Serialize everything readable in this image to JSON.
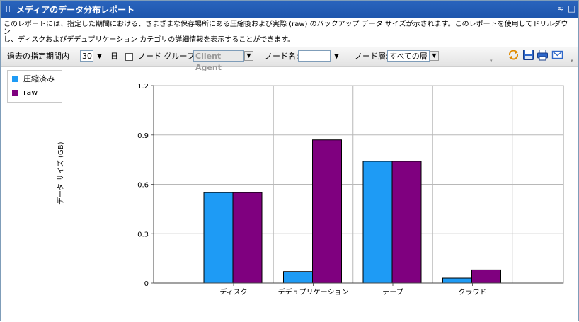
{
  "window": {
    "title": "メディアのデータ分布レポート",
    "grip": "|||",
    "collapse_icon": "≈",
    "maximize_icon": "□"
  },
  "description": {
    "line1": "このレポートには、指定した期間における、さまざまな保存場所にある圧縮後および実際 (raw) のバックアップ データ サイズが示されます。このレポートを使用してドリルダウン",
    "line2": "し、ディスクおよびデデュプリケーション カテゴリの詳細情報を表示することができます。"
  },
  "toolbar": {
    "period_label": "過去の指定期間内",
    "period_value": "30",
    "period_unit": "日",
    "node_group_label": "ノード グループ:",
    "node_group_value": "Client Agent",
    "node_name_label": "ノード名:",
    "node_name_value": "",
    "node_tier_label": "ノード層:",
    "node_tier_value": "すべての層",
    "icons": [
      "refresh-icon",
      "save-icon",
      "print-icon",
      "email-icon"
    ]
  },
  "colors": {
    "compressed": "#1e9bf5",
    "raw": "#7f007f",
    "title_bar": "#2a64bd"
  },
  "chart_data": {
    "type": "bar",
    "categories": [
      "ディスク",
      "デデュプリケーション",
      "テープ",
      "クラウド"
    ],
    "series": [
      {
        "name": "圧縮済み",
        "values": [
          0.55,
          0.07,
          0.74,
          0.03
        ]
      },
      {
        "name": "raw",
        "values": [
          0.55,
          0.87,
          0.74,
          0.08
        ]
      }
    ],
    "ylabel": "データ サイズ (GB)",
    "xlabel": "",
    "ylim": [
      0,
      1.2
    ],
    "yticks": [
      "0",
      "0.3",
      "0.6",
      "0.9",
      "1.2"
    ],
    "grid": true,
    "legend": "top-left"
  }
}
